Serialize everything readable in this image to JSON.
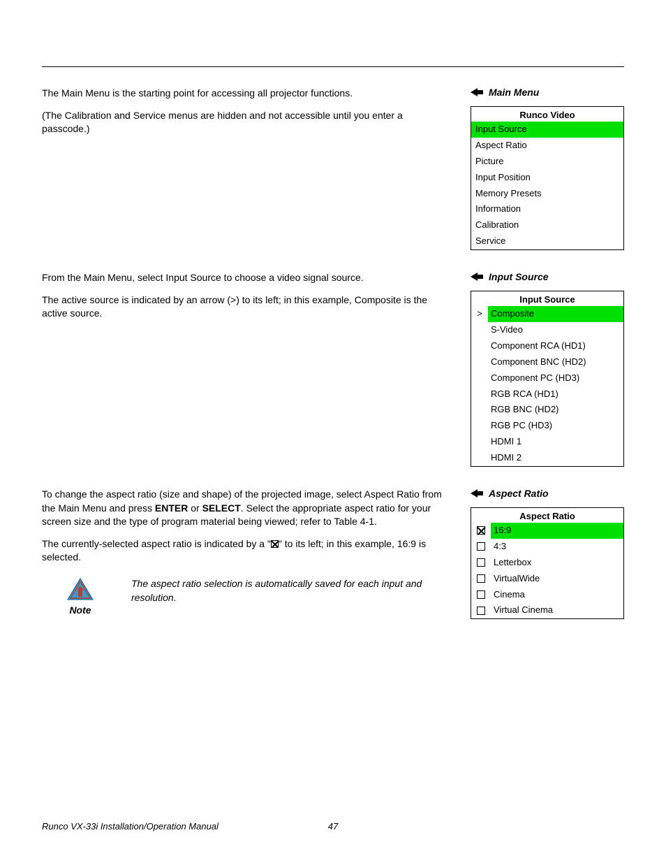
{
  "sections": {
    "main_menu": {
      "label": "Main Menu",
      "para1": "The Main Menu is the starting point for accessing all projector functions.",
      "para2": "(The Calibration and Service menus are hidden and not accessible until you enter a passcode.)",
      "box_title": "Runco Video",
      "items": [
        "Input Source",
        "Aspect Ratio",
        "Picture",
        "Input Position",
        "Memory Presets",
        "Information",
        "Calibration",
        "Service"
      ],
      "highlighted": 0
    },
    "input_source": {
      "label": "Input Source",
      "para1": "From the Main Menu, select Input Source to choose a video signal source.",
      "para2": "The active source is indicated by an arrow (>) to its left; in this example, Composite is the active source.",
      "box_title": "Input Source",
      "items": [
        "Composite",
        "S-Video",
        "Component RCA (HD1)",
        "Component BNC (HD2)",
        "Component PC (HD3)",
        "RGB RCA (HD1)",
        "RGB BNC (HD2)",
        "RGB PC (HD3)",
        "HDMI 1",
        "HDMI 2"
      ],
      "active": 0,
      "highlighted": 0
    },
    "aspect_ratio": {
      "label": "Aspect Ratio",
      "para1_a": "To change the aspect ratio (size and shape) of the projected image, select Aspect Ratio from the Main Menu and press ",
      "para1_b": "ENTER",
      "para1_c": " or ",
      "para1_d": "SELECT",
      "para1_e": ". Select the appropriate aspect ratio for your screen size and the type of program material being viewed; refer to Table 4-1.",
      "para2_a": "The currently-selected aspect ratio is indicated by a \"",
      "para2_b": "\" to its left; in this example, 16:9 is selected.",
      "box_title": "Aspect Ratio",
      "items": [
        "16:9",
        "4:3",
        "Letterbox",
        "VirtualWide",
        "Cinema",
        "Virtual Cinema"
      ],
      "selected": 0,
      "highlighted": 0,
      "note_label": "Note",
      "note_text": "The aspect ratio selection is automatically saved for each input and resolution."
    }
  },
  "footer": {
    "title": "Runco VX-33i Installation/Operation Manual",
    "page": "47"
  }
}
